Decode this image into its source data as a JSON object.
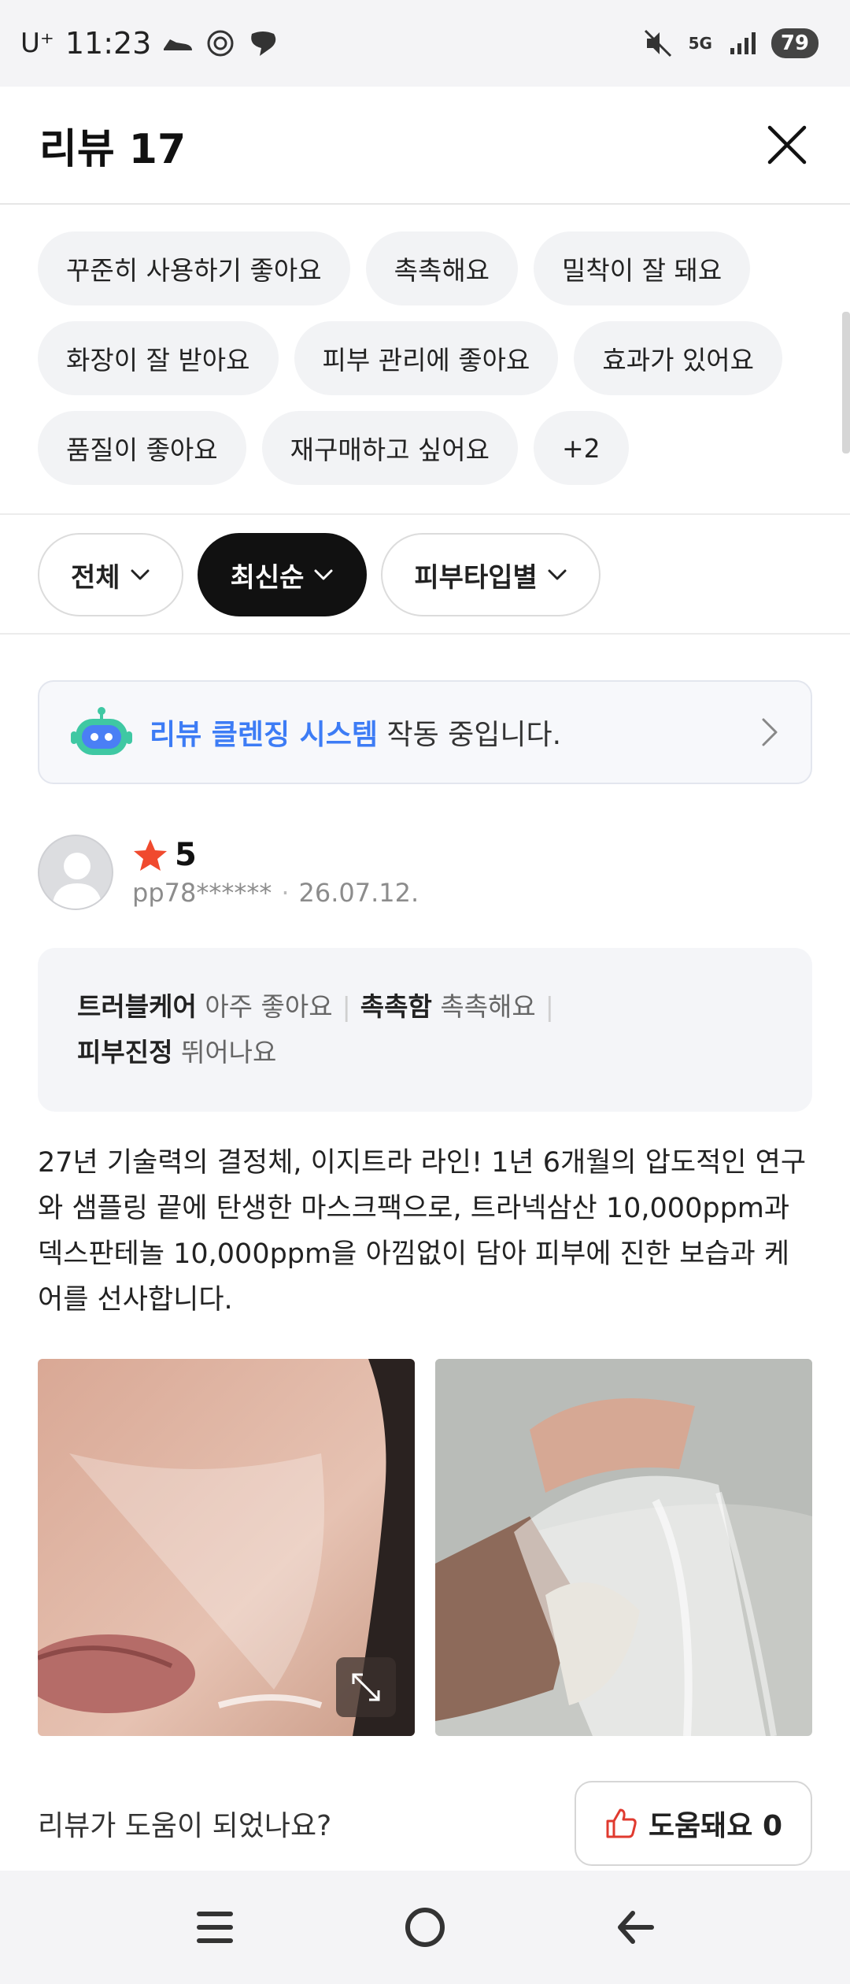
{
  "status_bar": {
    "carrier": "U⁺",
    "time": "11:23",
    "battery": "79",
    "network": "5G"
  },
  "header": {
    "title": "리뷰 17"
  },
  "keyword_tags": [
    [
      "꾸준히 사용하기 좋아요",
      "촉촉해요",
      "밀착이 잘 돼요"
    ],
    [
      "화장이 잘 받아요",
      "피부 관리에 좋아요",
      "효과가 있어요"
    ],
    [
      "품질이 좋아요",
      "재구매하고 싶어요",
      "+2"
    ]
  ],
  "filters": [
    {
      "label": "전체",
      "active": false
    },
    {
      "label": "최신순",
      "active": true
    },
    {
      "label": "피부타입별",
      "active": false
    }
  ],
  "banner": {
    "highlight": "리뷰 클렌징 시스템",
    "text": " 작동 중입니다."
  },
  "review": {
    "rating": "5",
    "user": "pp78******",
    "date": "26.07.12.",
    "attributes": [
      {
        "name": "트러블케어",
        "value": "아주 좋아요"
      },
      {
        "name": "촉촉함",
        "value": "촉촉해요"
      },
      {
        "name": "피부진정",
        "value": "뛰어나요"
      }
    ],
    "body": "27년 기술력의 결정체, 이지트라 라인! 1년 6개월의 압도적인 연구와 샘플링 끝에 탄생한 마스크팩으로, 트라넥삼산 10,000ppm과 덱스판테놀 10,000ppm을 아낌없이 담아 피부에 진한 보습과 케어를 선사합니다."
  },
  "helpful": {
    "question": "리뷰가 도움이 되었나요?",
    "button": "도움돼요 0"
  },
  "colors": {
    "accent_blue": "#3d7cf5",
    "star_red": "#f04a2e",
    "active_filter": "#111111"
  }
}
